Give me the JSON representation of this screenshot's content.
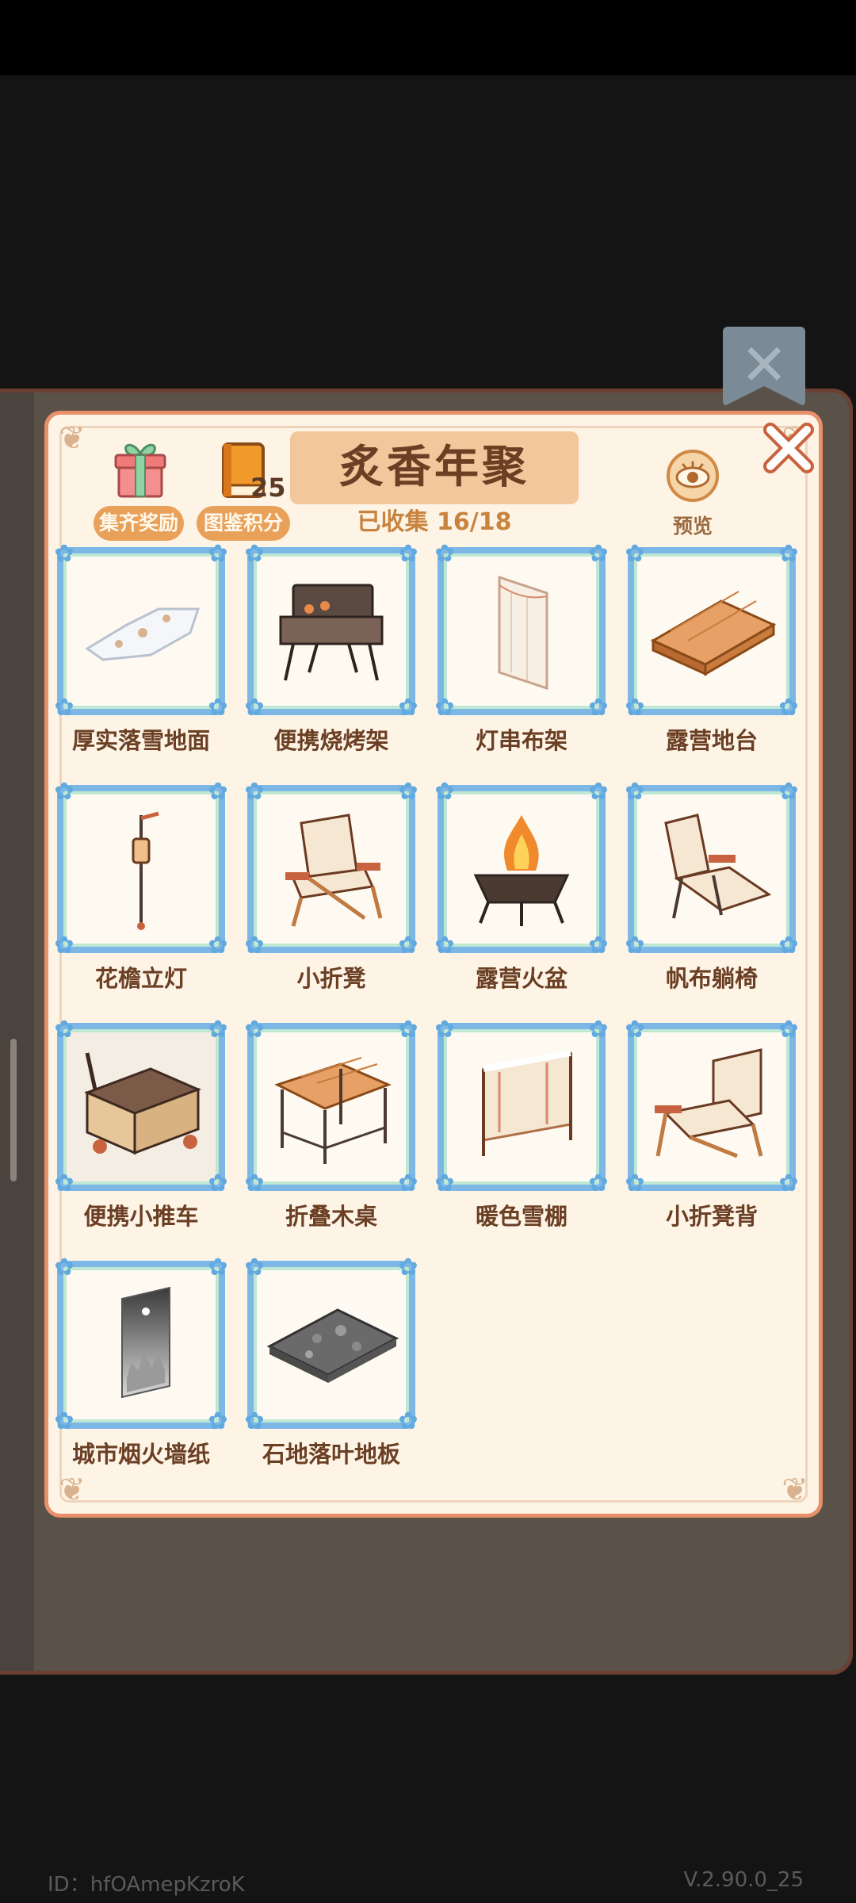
{
  "header": {
    "title": "炙香年聚",
    "collected_text": "已收集 16/18",
    "reward_label": "集齐奖励",
    "points_label": "图鉴积分",
    "points_value": "25",
    "preview_label": "预览"
  },
  "items": [
    {
      "name": "厚实落雪地面",
      "icon": "snow-floor-icon"
    },
    {
      "name": "便携烧烤架",
      "icon": "grill-icon"
    },
    {
      "name": "灯串布架",
      "icon": "curtain-icon"
    },
    {
      "name": "露营地台",
      "icon": "wood-platform-icon"
    },
    {
      "name": "花檐立灯",
      "icon": "lantern-icon"
    },
    {
      "name": "小折凳",
      "icon": "folding-chair-icon"
    },
    {
      "name": "露营火盆",
      "icon": "fire-pit-icon"
    },
    {
      "name": "帆布躺椅",
      "icon": "lounge-chair-icon"
    },
    {
      "name": "便携小推车",
      "icon": "cart-icon"
    },
    {
      "name": "折叠木桌",
      "icon": "wood-table-icon"
    },
    {
      "name": "暖色雪棚",
      "icon": "snow-shed-icon"
    },
    {
      "name": "小折凳背",
      "icon": "chair-back-icon"
    },
    {
      "name": "城市烟火墙纸",
      "icon": "wallpaper-icon"
    },
    {
      "name": "石地落叶地板",
      "icon": "stone-floor-icon"
    }
  ],
  "footer": {
    "id_text": "ID：hfOAmepKzroK",
    "version": "V.2.90.0_25"
  },
  "colors": {
    "panel_bg": "#fdf4e6",
    "frame_blue": "#7db7e6",
    "title_bg": "#f3c79c",
    "text_brown": "#6b3f24",
    "accent_orange": "#e9a15a"
  }
}
